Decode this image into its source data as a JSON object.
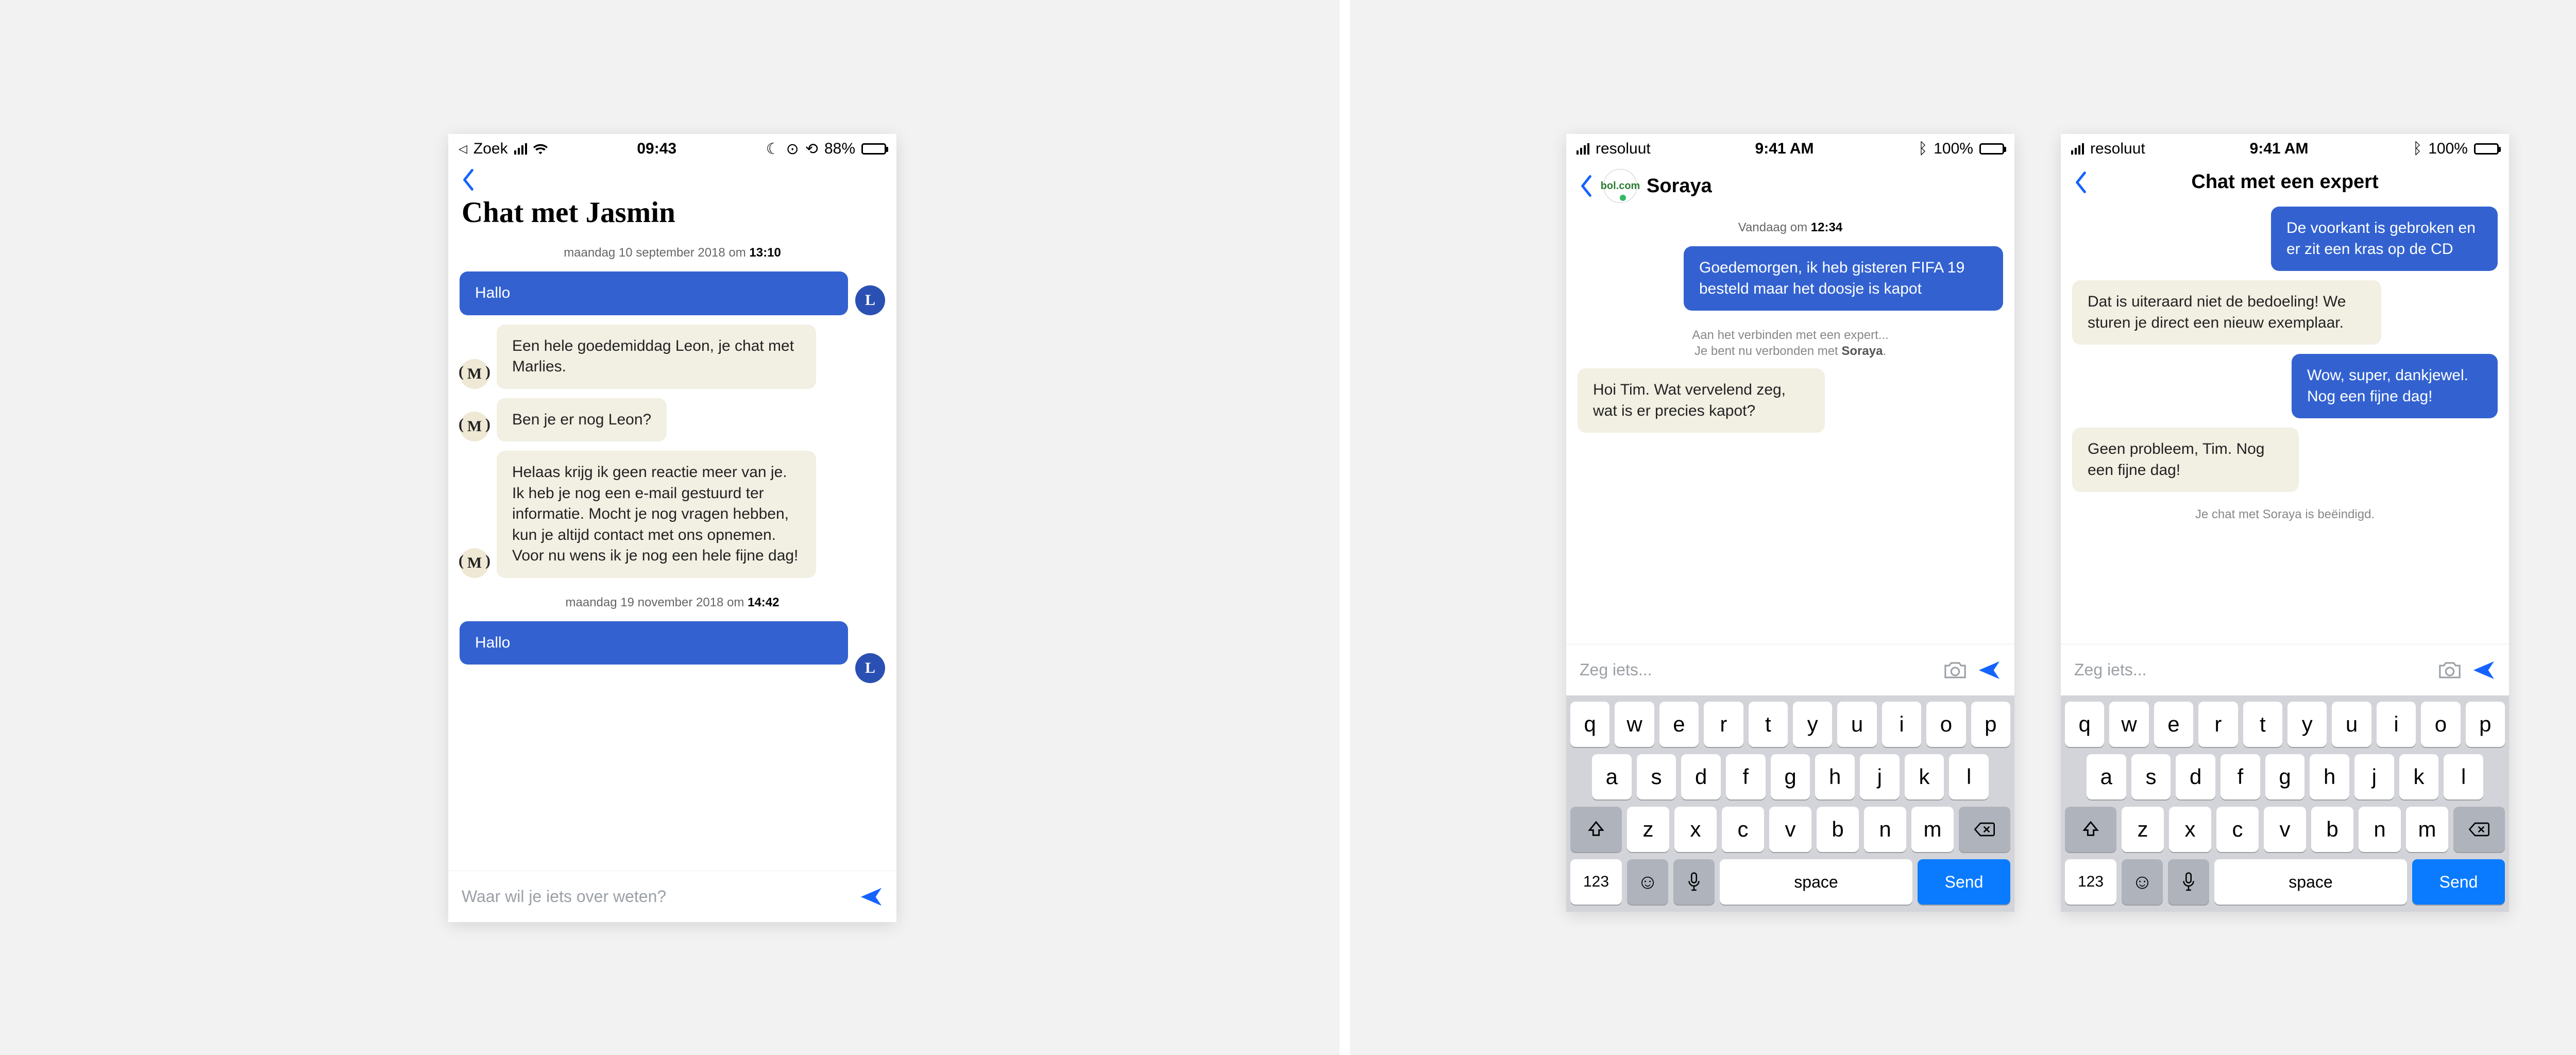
{
  "phone_a": {
    "status": {
      "carrier_name": "Zoek",
      "carrier_icon": "◁",
      "time": "09:43",
      "right_icons": [
        "moon",
        "alarm",
        "dnd"
      ],
      "battery_pct": "88%",
      "battery_fill": 0.88
    },
    "title": "Chat met Jasmin",
    "date_sep_1": {
      "prefix": "maandag 10 september 2018 om ",
      "time": "13:10"
    },
    "msg1": "Hallo",
    "avatar_out": "L",
    "avatar_in": "M",
    "msg2": "Een hele goedemiddag Leon, je chat met Marlies.",
    "msg3": "Ben je er nog Leon?",
    "msg4": "Helaas krijg ik geen reactie meer van je. Ik heb je nog een e-mail gestuurd ter informatie. Mocht je nog vragen hebben, kun je altijd contact met ons opnemen. Voor nu wens ik je nog een hele fijne dag!",
    "date_sep_2": {
      "prefix": "maandag 19 november 2018 om ",
      "time": "14:42"
    },
    "msg5": "Hallo",
    "input_placeholder": "Waar wil je iets over weten?"
  },
  "phone_b": {
    "status": {
      "carrier": "resoluut",
      "time": "9:41 AM",
      "battery_pct": "100%",
      "battery_fill": 1.0,
      "bluetooth": true
    },
    "nav_title": "Soraya",
    "date_sep": {
      "prefix": "Vandaag om ",
      "time": "12:34"
    },
    "msg_out": "Goedemorgen, ik heb gisteren FIFA 19 besteld maar het doosje is kapot",
    "sys_line_1": "Aan het verbinden met een expert...",
    "sys_line_2_pre": "Je bent nu verbonden met ",
    "sys_line_2_name": "Soraya",
    "sys_line_2_post": ".",
    "msg_in": "Hoi Tim. Wat vervelend zeg, wat is er precies kapot?",
    "input_placeholder": "Zeg iets..."
  },
  "phone_c": {
    "status": {
      "carrier": "resoluut",
      "time": "9:41 AM",
      "battery_pct": "100%",
      "battery_fill": 1.0,
      "bluetooth": true
    },
    "nav_title": "Chat met een expert",
    "msg_out_1": "De voorkant is gebroken en er zit een kras op de CD",
    "msg_in_1": "Dat is uiteraard niet de bedoeling! We sturen je direct een nieuw exemplaar.",
    "msg_out_2": "Wow, super, dankjewel. Nog een fijne dag!",
    "msg_in_2": "Geen probleem, Tim. Nog een fijne dag!",
    "sys_end": "Je chat met Soraya is beëindigd.",
    "input_placeholder": "Zeg iets..."
  },
  "keyboard": {
    "row1": [
      "q",
      "w",
      "e",
      "r",
      "t",
      "y",
      "u",
      "i",
      "o",
      "p"
    ],
    "row2": [
      "a",
      "s",
      "d",
      "f",
      "g",
      "h",
      "j",
      "k",
      "l"
    ],
    "row3": [
      "z",
      "x",
      "c",
      "v",
      "b",
      "n",
      "m"
    ],
    "space_label": "space",
    "send_label": "Send",
    "num_label": "123"
  }
}
